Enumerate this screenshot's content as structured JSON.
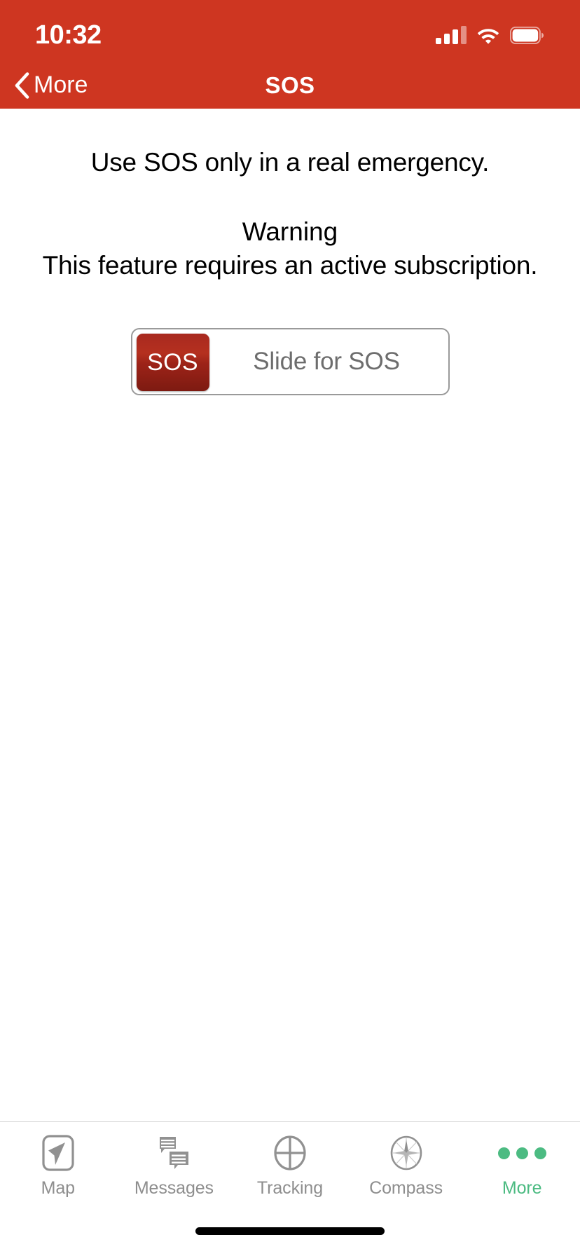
{
  "status_bar": {
    "time": "10:32",
    "signal_icon": "cellular-signal-icon",
    "wifi_icon": "wifi-icon",
    "battery_icon": "battery-icon"
  },
  "nav_bar": {
    "back_icon": "chevron-left-icon",
    "back_label": "More",
    "title": "SOS",
    "background_color": "#CE3621",
    "text_color": "#FFFFFF"
  },
  "main": {
    "intro": "Use SOS only in a real emergency.",
    "warning_title": "Warning",
    "warning_body": "This feature requires an active subscription.",
    "slider": {
      "thumb_label": "SOS",
      "hint_label": "Slide for SOS",
      "thumb_color": "#A8291F",
      "hint_color": "#6D6D6D"
    }
  },
  "tab_bar": {
    "active_color": "#4CBB82",
    "inactive_color": "#8E8E8E",
    "items": [
      {
        "label": "Map",
        "icon": "map-navigation-arrow-icon",
        "active": false
      },
      {
        "label": "Messages",
        "icon": "speech-bubbles-icon",
        "active": false
      },
      {
        "label": "Tracking",
        "icon": "crosshair-circle-icon",
        "active": false
      },
      {
        "label": "Compass",
        "icon": "compass-rose-icon",
        "active": false
      },
      {
        "label": "More",
        "icon": "three-dots-icon",
        "active": true
      }
    ]
  },
  "home_indicator": {
    "label": "home-indicator"
  }
}
